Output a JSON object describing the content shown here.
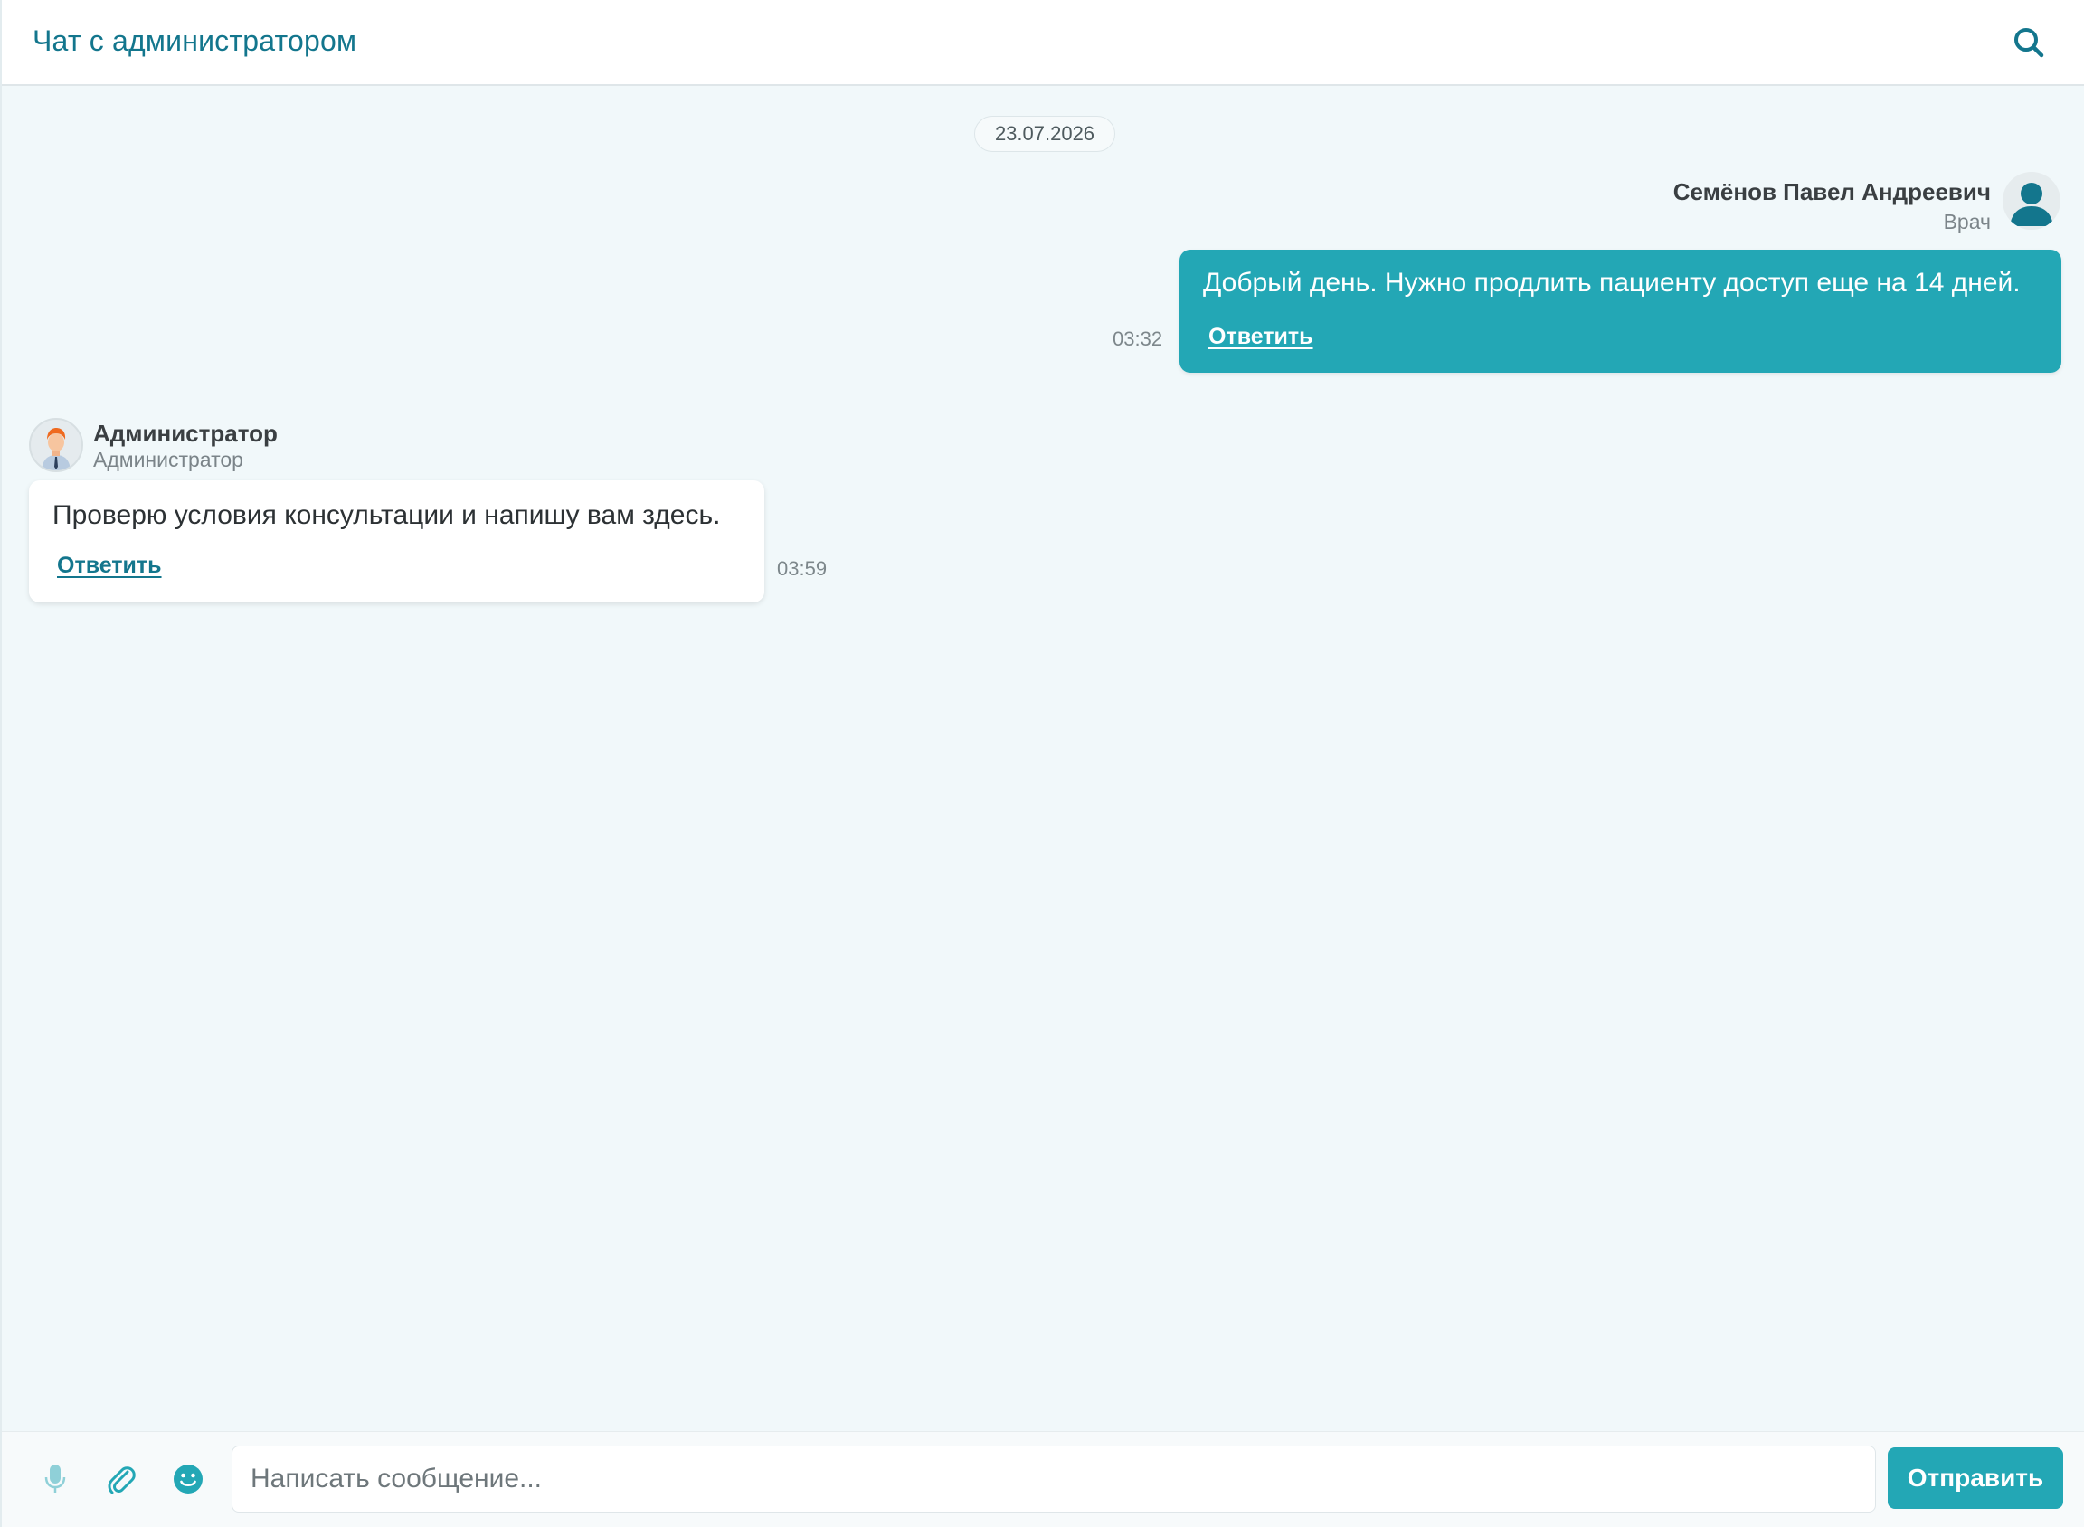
{
  "header": {
    "title": "Чат с администратором",
    "search_icon": "search-icon"
  },
  "date_separator": "23.07.2026",
  "messages": [
    {
      "direction": "outgoing",
      "author": "Семёнов Павел Андреевич",
      "role": "Врач",
      "avatar": "user-silhouette-icon",
      "text": "Добрый день. Нужно продлить пациенту доступ еще на 14 дней.",
      "reply_label": "Ответить",
      "time": "03:32"
    },
    {
      "direction": "incoming",
      "author": "Администратор",
      "role": "Администратор",
      "avatar": "admin-avatar",
      "text": "Проверю условия консультации и напишу вам здесь.",
      "reply_label": "Ответить",
      "time": "03:59"
    }
  ],
  "composer": {
    "placeholder": "Написать сообщение...",
    "value": "",
    "send_label": "Отправить",
    "icons": [
      "microphone-icon",
      "paperclip-icon",
      "emoji-icon"
    ]
  },
  "colors": {
    "accent": "#23a7b5",
    "title": "#13768d",
    "background": "#f1f8fa"
  }
}
